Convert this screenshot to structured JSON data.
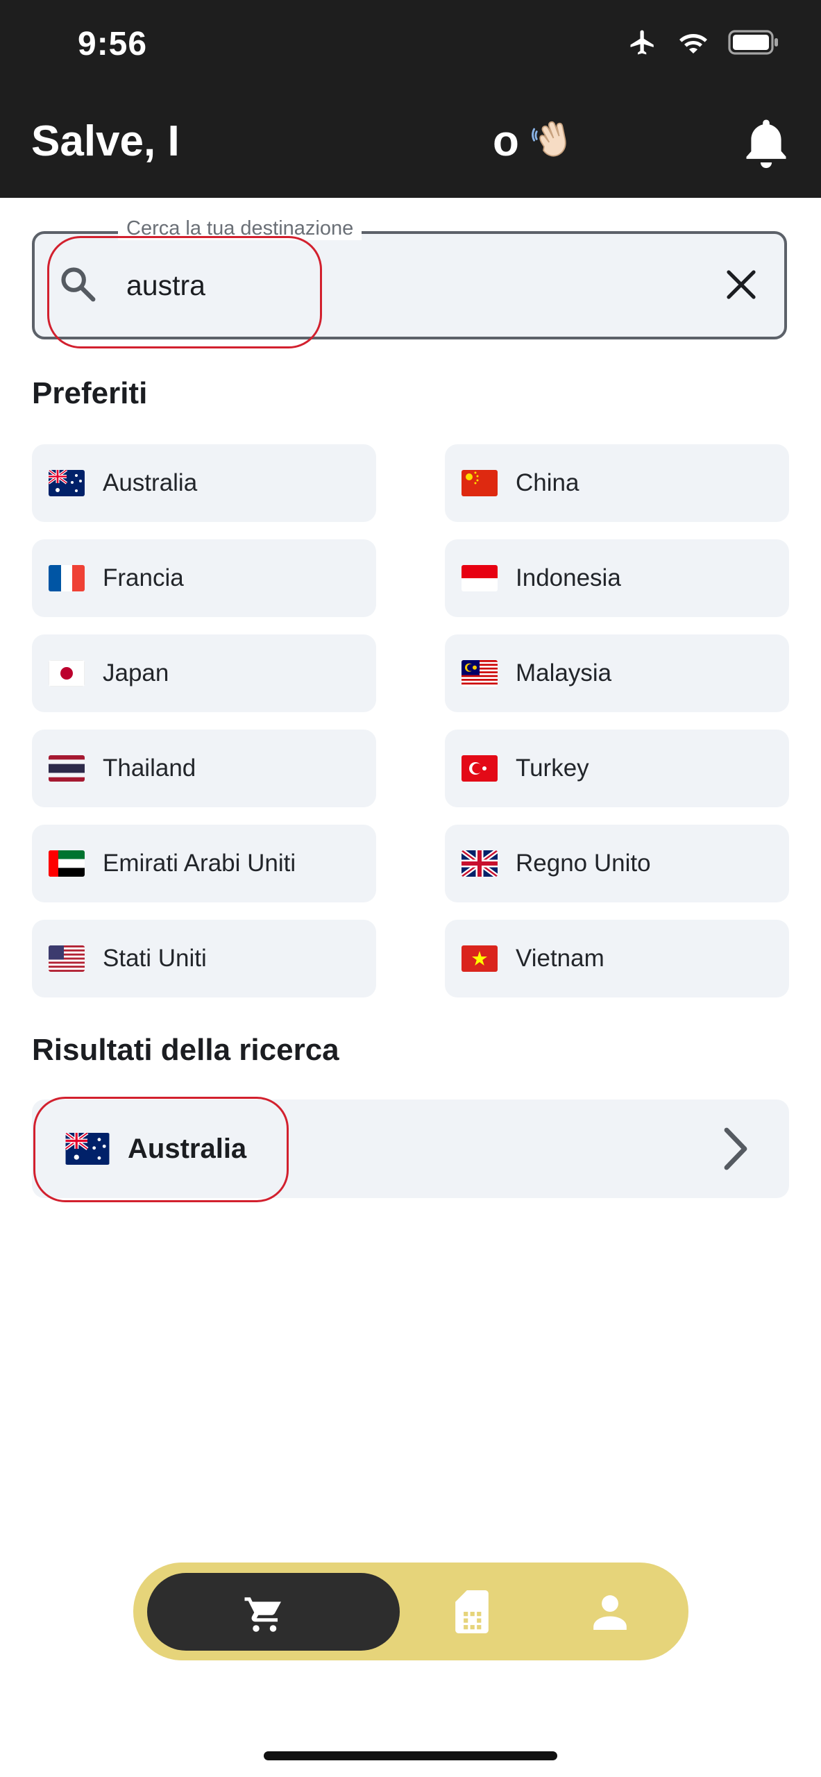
{
  "status_bar": {
    "time": "9:56"
  },
  "header": {
    "greeting_start": "Salve, I",
    "greeting_end": "o"
  },
  "search": {
    "label": "Cerca la tua destinazione",
    "value": "austra"
  },
  "favorites": {
    "title": "Preferiti",
    "items": [
      {
        "label": "Australia",
        "flag": "au"
      },
      {
        "label": "China",
        "flag": "cn"
      },
      {
        "label": "Francia",
        "flag": "fr"
      },
      {
        "label": "Indonesia",
        "flag": "id"
      },
      {
        "label": "Japan",
        "flag": "jp"
      },
      {
        "label": "Malaysia",
        "flag": "my"
      },
      {
        "label": "Thailand",
        "flag": "th"
      },
      {
        "label": "Turkey",
        "flag": "tr"
      },
      {
        "label": "Emirati Arabi Uniti",
        "flag": "ae"
      },
      {
        "label": "Regno Unito",
        "flag": "gb"
      },
      {
        "label": "Stati Uniti",
        "flag": "us"
      },
      {
        "label": "Vietnam",
        "flag": "vn"
      }
    ]
  },
  "results": {
    "title": "Risultati della ricerca",
    "items": [
      {
        "label": "Australia",
        "flag": "au"
      }
    ]
  },
  "colors": {
    "header_bg": "#1e1e1e",
    "chip_bg": "#f0f3f7",
    "nav_bg": "#e6d47a",
    "nav_active": "#2d2d2d",
    "annotation": "#d2202e"
  },
  "nav": {
    "items": [
      {
        "icon": "cart-icon",
        "active": true
      },
      {
        "icon": "sim-card-icon",
        "active": false
      },
      {
        "icon": "profile-icon",
        "active": false
      }
    ]
  }
}
